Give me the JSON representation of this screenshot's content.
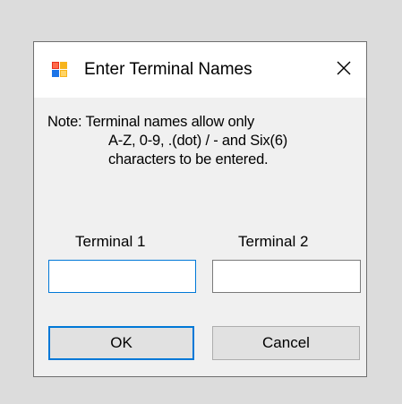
{
  "window": {
    "title": "Enter Terminal Names",
    "icon": "app-form-icon",
    "close_icon": "close-icon"
  },
  "note": {
    "line1": "Note: Terminal names allow only",
    "line2": "A-Z, 0-9, .(dot) / - and Six(6)",
    "line3": "characters to be entered."
  },
  "fields": {
    "terminal1": {
      "label": "Terminal 1",
      "value": ""
    },
    "terminal2": {
      "label": "Terminal 2",
      "value": ""
    }
  },
  "buttons": {
    "ok": "OK",
    "cancel": "Cancel"
  },
  "colors": {
    "focus_accent": "#0078d7",
    "dialog_bg": "#f0f0f0",
    "titlebar_bg": "#ffffff"
  }
}
